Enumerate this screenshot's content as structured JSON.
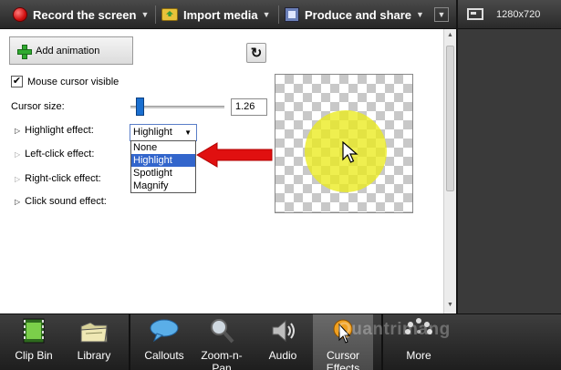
{
  "toolbar": {
    "record_label": "Record the screen",
    "import_label": "Import media",
    "produce_label": "Produce and share",
    "caret": "▼",
    "collapse": "▼"
  },
  "right_panel": {
    "resolution": "1280x720"
  },
  "main": {
    "add_animation_label": "Add animation",
    "reset_glyph": "↻",
    "cursor_visible": {
      "label": "Mouse cursor visible",
      "checked": true,
      "mark": "✔"
    },
    "cursor_size": {
      "label": "Cursor size:",
      "value": "1.26"
    },
    "effects": {
      "highlight": {
        "label": "Highlight effect:"
      },
      "left_click": {
        "label": "Left-click effect:"
      },
      "right_click": {
        "label": "Right-click effect:"
      },
      "click_sound": {
        "label": "Click sound effect:"
      }
    },
    "highlight_select": {
      "value": "Highlight",
      "caret": "▼",
      "options": [
        "None",
        "Highlight",
        "Spotlight",
        "Magnify"
      ],
      "selected_index": 1
    },
    "triangle": "▷",
    "highlight_color": "#ebeb1e",
    "arrow_color": "#e01010"
  },
  "bottom_tabs": {
    "clip_bin": "Clip Bin",
    "library": "Library",
    "callouts": "Callouts",
    "zoom_line1": "Zoom-n-",
    "zoom_line2": "Pan",
    "audio": "Audio",
    "cursor_line1": "Cursor",
    "cursor_line2": "Effects",
    "more": "More",
    "watermark": "Quantrimang"
  },
  "icons": {
    "record": "record-dot-icon",
    "import": "import-folder-icon",
    "produce": "film-icon",
    "resolution": "screen-resolution-icon",
    "add": "green-plus-icon",
    "reset": "reset-arrow-icon"
  }
}
